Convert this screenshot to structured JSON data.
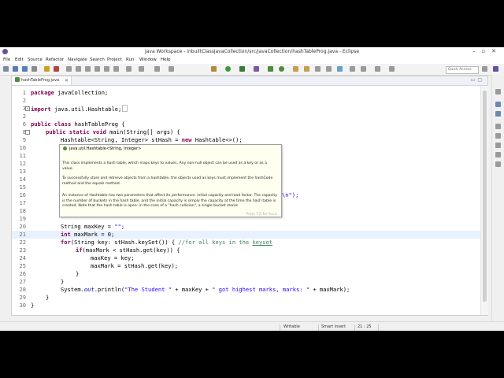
{
  "window": {
    "title": "Java Workspace - inbuiltClassJavaCollection/src/javaCollection/hashTableProg.java - Eclipse"
  },
  "menu": [
    "File",
    "Edit",
    "Source",
    "Refactor",
    "Navigate",
    "Search",
    "Project",
    "Run",
    "Window",
    "Help"
  ],
  "toolbar": {
    "quick_access_placeholder": "Quick Access"
  },
  "editor_tab": {
    "label": "hashTableProg.java",
    "close": "✕"
  },
  "code": {
    "lines": [
      {
        "n": "1",
        "text": "package javaCollection;"
      },
      {
        "n": "2",
        "text": ""
      },
      {
        "n": "3",
        "text": "import java.util.Hashtable;"
      },
      {
        "n": "6",
        "text": "public class hashTableProg {"
      },
      {
        "n": "8",
        "text": "public static void main(String[] args) {"
      },
      {
        "n": "9",
        "text": "Hashtable<String, Integer> stHash = new Hashtable<>();"
      },
      {
        "n": "10",
        "text": ""
      },
      {
        "n": "11",
        "text": ""
      },
      {
        "n": "12",
        "text": ""
      },
      {
        "n": "13",
        "text": ""
      },
      {
        "n": "14",
        "text": ""
      },
      {
        "n": "15",
        "text": ""
      },
      {
        "n": "16",
        "text": "\\n\");"
      },
      {
        "n": "17",
        "text": ""
      },
      {
        "n": "18",
        "text": ""
      },
      {
        "n": "19",
        "text": ""
      },
      {
        "n": "20",
        "text": "String maxKey = \"\";"
      },
      {
        "n": "21",
        "text": "int maxMark = 0;"
      },
      {
        "n": "22",
        "text": "for(String key: stHash.keySet()) { //for all keys in the keyset"
      },
      {
        "n": "23",
        "text": "if(maxMark < stHash.get(key)) {"
      },
      {
        "n": "24",
        "text": "maxKey = key;"
      },
      {
        "n": "25",
        "text": "maxMark = stHash.get(key);"
      },
      {
        "n": "26",
        "text": "}"
      },
      {
        "n": "27",
        "text": "}"
      },
      {
        "n": "28",
        "text": "System.out.println(\"The Student \" + maxKey + \" got highest marks, marks: \" + maxMark);"
      },
      {
        "n": "29",
        "text": "}"
      },
      {
        "n": "30",
        "text": "}"
      }
    ]
  },
  "tooltip": {
    "header": "java.util.Hashtable<String, Integer>",
    "p1": "This class implements a hash table, which maps keys to values. Any non-null object can be used as a key or as a value.",
    "p2": "To successfully store and retrieve objects from a hashtable, the objects used as keys must implement the hashCode method and the equals method.",
    "p3": "An instance of Hashtable has two parameters that affect its performance: initial capacity and load factor. The capacity is the number of buckets in the hash table, and the initial capacity is simply the capacity at the time the hash table is created. Note that the hash table is open: in the case of a \"hash collision\", a single bucket stores",
    "footer": "Press 'F2' for focus"
  },
  "status": {
    "mode": "Writable",
    "insert": "Smart Insert",
    "position": "21 : 25"
  }
}
